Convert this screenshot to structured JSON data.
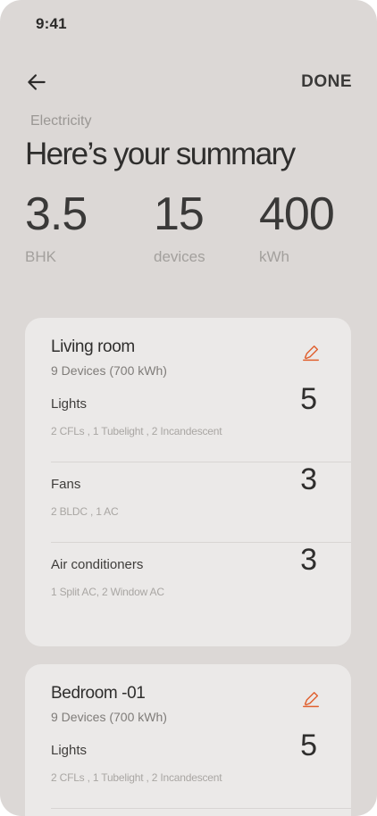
{
  "status": {
    "time": "9:41"
  },
  "header": {
    "done_label": "DONE"
  },
  "summary": {
    "category": "Electricity",
    "title": "Here’s your summary",
    "stats": [
      {
        "value": "3.5",
        "label": "BHK"
      },
      {
        "value": "15",
        "label": "devices"
      },
      {
        "value": "400",
        "label": "kWh"
      }
    ]
  },
  "rooms": [
    {
      "name": "Living room",
      "subtitle": "9 Devices (700 kWh)",
      "items": [
        {
          "name": "Lights",
          "count": "5",
          "detail": "2 CFLs , 1 Tubelight , 2 Incandescent"
        },
        {
          "name": "Fans",
          "count": "3",
          "detail": "2 BLDC , 1 AC"
        },
        {
          "name": "Air conditioners",
          "count": "3",
          "detail": "1 Split AC, 2 Window AC"
        }
      ]
    },
    {
      "name": "Bedroom -01",
      "subtitle": "9 Devices (700 kWh)",
      "items": [
        {
          "name": "Lights",
          "count": "5",
          "detail": "2 CFLs , 1 Tubelight , 2 Incandescent"
        }
      ]
    }
  ],
  "colors": {
    "accent": "#e0602f",
    "background": "#dcd8d6",
    "card": "#ebe9e8"
  }
}
